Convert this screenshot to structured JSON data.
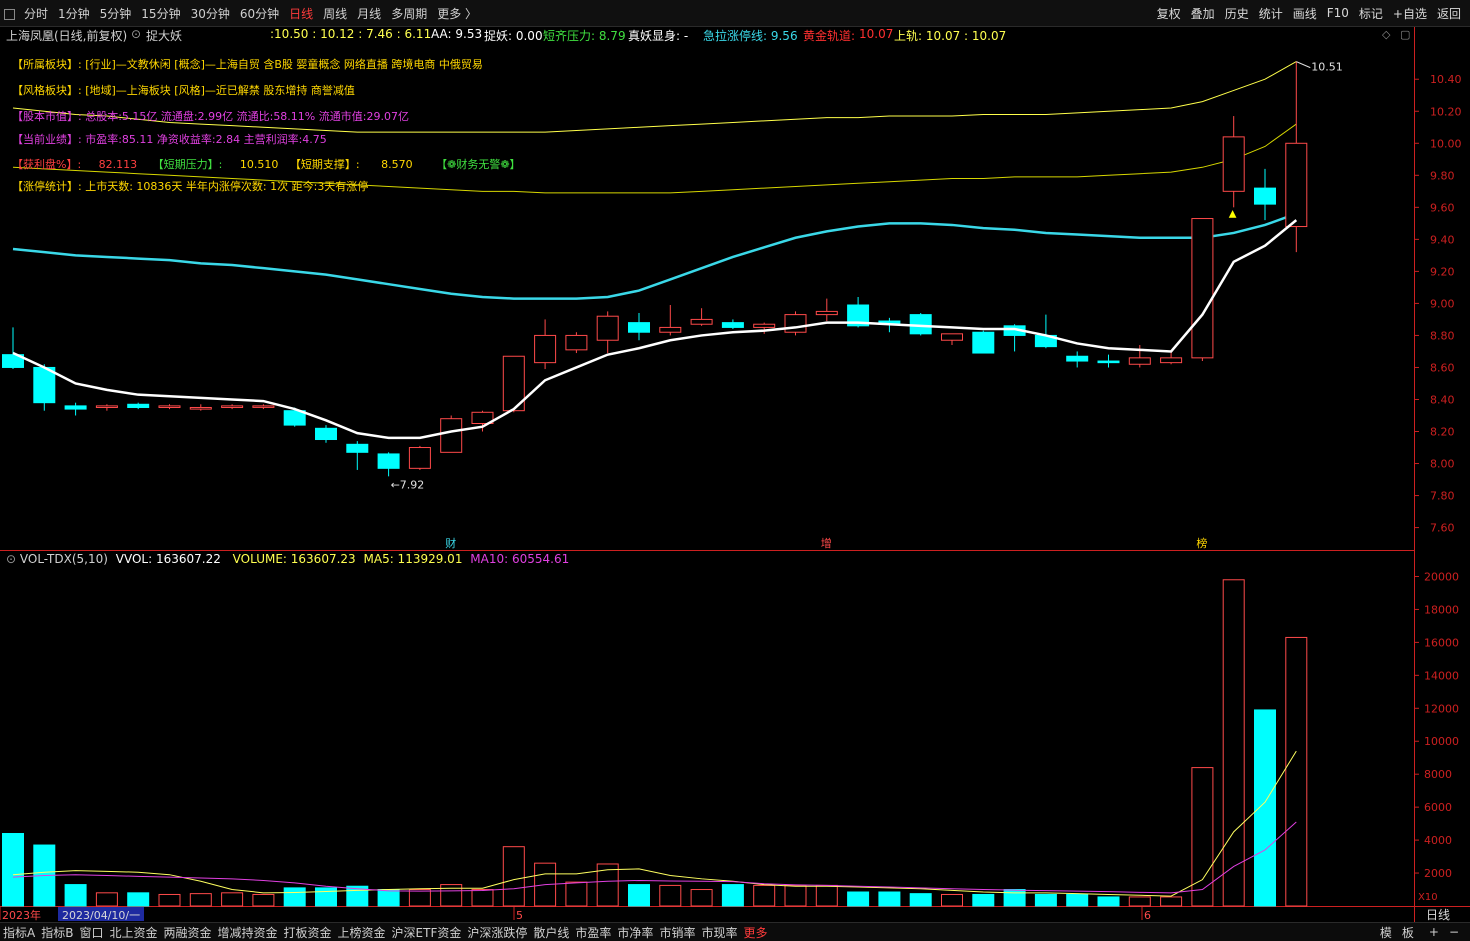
{
  "topbar": {
    "back_icon": "checkbox-square-icon",
    "periods": [
      "分时",
      "1分钟",
      "5分钟",
      "15分钟",
      "30分钟",
      "60分钟",
      "日线",
      "周线",
      "月线",
      "多周期",
      "更多 〉"
    ],
    "active_period": "日线",
    "tools": [
      "复权",
      "叠加",
      "历史",
      "统计",
      "画线",
      "F10",
      "标记",
      "+自选",
      "返回"
    ]
  },
  "infobar": {
    "stock": "上海凤凰(日线,前复权)",
    "indicator_icon": "settings-circle-icon",
    "indicator": "捉大妖",
    "values": ":10.50 : 10.12 : 7.46 : 6.11",
    "aa": "AA: 9.53",
    "zy": "捉妖: 0.00",
    "dqyl": "短齐压力: 8.79",
    "zyxs": "真妖显身: -",
    "jlzt": "急拉涨停线: 9.56",
    "hjgd_label": "黄金轨道:",
    "hjgd_value": "10.07",
    "sg": "上轨: 10.07 : 10.07"
  },
  "fundamentals": [
    {
      "label": "【所属板块】:",
      "text": "[行业]—文教休闲 [概念]—上海自贸 含B股 婴童概念 网络直播 跨境电商 中俄贸易",
      "label_color": "#ffd700",
      "text_color": "#ffd700"
    },
    {
      "label": "【风格板块】:",
      "text": "[地域]—上海板块 [风格]—近已解禁 股东增持 商誉减值",
      "label_color": "#ffd700",
      "text_color": "#ffd700"
    },
    {
      "label": "【股本市值】:",
      "text": "总股本:5.15亿 流通盘:2.99亿 流通比:58.11% 流通市值:29.07亿",
      "label_color": "#e040e0",
      "text_color": "#e040e0"
    },
    {
      "label": "【当前业绩】:",
      "text": "市盈率:85.11 净资收益率:2.84 主营利润率:4.75",
      "label_color": "#e040e0",
      "text_color": "#e040e0"
    },
    {
      "label": "【获利盘%】:",
      "text": "82.113",
      "label_color": "#ff4040",
      "text_color": "#ff4040"
    },
    {
      "label": "【涨停统计】:",
      "text": "上市天数: 10836天 半年内涨停次数: 1次  距今:3天有涨停",
      "label_color": "#ffd700",
      "text_color": "#ffd700"
    }
  ],
  "fund_row5": {
    "dqyl_label": "【短期压力】:",
    "dqyl_value": "10.510",
    "dqzc_label": "【短期支撑】:",
    "dqzc_value": "8.570",
    "cwwj": "【❁财务无警❁】"
  },
  "vol_info": {
    "name": "VOL-TDX(5,10)",
    "vvol": "VVOL: 163607.22",
    "volume": "VOLUME: 163607.23",
    "ma5": "MA5: 113929.01",
    "ma10": "MA10: 60554.61"
  },
  "bottombar": {
    "tabs": [
      "指标A",
      "指标B",
      "窗口",
      "北上资金",
      "两融资金",
      "增减持资金",
      "打板资金",
      "上榜资金",
      "沪深ETF资金",
      "沪深涨跌停",
      "散户线",
      "市盈率",
      "市净率",
      "市销率",
      "市现率",
      "更多"
    ],
    "right": [
      "模",
      "板",
      "+",
      "−"
    ]
  },
  "colors": {
    "up": "#ff4a4a",
    "down": "#00ffff",
    "ma": "#ffffff",
    "env_upper": "#ffff4a",
    "env_mid": "#d6d600",
    "env_lower": "#c8c800",
    "boll_mid": "#3ad8e8",
    "ma5": "#ffff60",
    "ma10": "#e040e0",
    "axis": "#cc2020"
  },
  "chart_data": [
    {
      "type": "candlestick",
      "ylim": [
        7.46,
        10.62
      ],
      "y_ticks": [
        7.6,
        7.8,
        8.0,
        8.2,
        8.4,
        8.6,
        8.8,
        9.0,
        9.2,
        9.4,
        9.6,
        9.8,
        10.0,
        10.2,
        10.4
      ],
      "annotations": {
        "high": "10.51",
        "low": "7.92",
        "markers": [
          "财",
          "增",
          "榜"
        ],
        "tiny_triangle": "▲"
      },
      "ohlc": [
        [
          8.68,
          8.85,
          8.59,
          8.6
        ],
        [
          8.6,
          8.62,
          8.33,
          8.38
        ],
        [
          8.36,
          8.38,
          8.3,
          8.34
        ],
        [
          8.35,
          8.37,
          8.33,
          8.36
        ],
        [
          8.37,
          8.38,
          8.34,
          8.35
        ],
        [
          8.35,
          8.37,
          8.34,
          8.36
        ],
        [
          8.34,
          8.37,
          8.33,
          8.35
        ],
        [
          8.35,
          8.37,
          8.34,
          8.36
        ],
        [
          8.36,
          8.37,
          8.34,
          8.36
        ],
        [
          8.33,
          8.35,
          8.23,
          8.24
        ],
        [
          8.22,
          8.24,
          8.13,
          8.15
        ],
        [
          8.12,
          8.14,
          7.96,
          8.07
        ],
        [
          8.06,
          8.07,
          7.92,
          7.97
        ],
        [
          7.97,
          8.11,
          7.96,
          8.1
        ],
        [
          8.07,
          8.3,
          8.07,
          8.28
        ],
        [
          8.25,
          8.33,
          8.2,
          8.32
        ],
        [
          8.33,
          8.67,
          8.32,
          8.67
        ],
        [
          8.63,
          8.9,
          8.59,
          8.8
        ],
        [
          8.71,
          8.82,
          8.69,
          8.8
        ],
        [
          8.77,
          8.95,
          8.69,
          8.92
        ],
        [
          8.88,
          8.94,
          8.77,
          8.82
        ],
        [
          8.82,
          8.99,
          8.8,
          8.85
        ],
        [
          8.87,
          8.97,
          8.86,
          8.9
        ],
        [
          8.88,
          8.9,
          8.84,
          8.85
        ],
        [
          8.85,
          8.88,
          8.81,
          8.87
        ],
        [
          8.82,
          8.95,
          8.8,
          8.93
        ],
        [
          8.93,
          9.03,
          8.89,
          8.95
        ],
        [
          8.99,
          9.04,
          8.85,
          8.86
        ],
        [
          8.89,
          8.91,
          8.82,
          8.87
        ],
        [
          8.93,
          8.94,
          8.8,
          8.81
        ],
        [
          8.77,
          8.81,
          8.74,
          8.81
        ],
        [
          8.82,
          8.83,
          8.7,
          8.69
        ],
        [
          8.86,
          8.87,
          8.7,
          8.8
        ],
        [
          8.8,
          8.93,
          8.72,
          8.73
        ],
        [
          8.67,
          8.7,
          8.6,
          8.64
        ],
        [
          8.64,
          8.68,
          8.6,
          8.63
        ],
        [
          8.62,
          8.74,
          8.6,
          8.66
        ],
        [
          8.63,
          8.7,
          8.62,
          8.66
        ],
        [
          8.66,
          9.53,
          8.64,
          9.53
        ],
        [
          9.7,
          10.17,
          9.6,
          10.04
        ],
        [
          9.72,
          9.84,
          9.52,
          9.62
        ],
        [
          9.48,
          10.51,
          9.32,
          10.0
        ]
      ],
      "ma": [
        8.69,
        8.6,
        8.5,
        8.46,
        8.43,
        8.42,
        8.41,
        8.4,
        8.39,
        8.34,
        8.27,
        8.19,
        8.16,
        8.16,
        8.2,
        8.23,
        8.34,
        8.52,
        8.6,
        8.68,
        8.72,
        8.77,
        8.8,
        8.82,
        8.83,
        8.85,
        8.88,
        8.88,
        8.87,
        8.86,
        8.85,
        8.84,
        8.84,
        8.8,
        8.75,
        8.72,
        8.71,
        8.7,
        8.93,
        9.26,
        9.36,
        9.52
      ],
      "boll_mid": [
        9.34,
        9.32,
        9.3,
        9.29,
        9.28,
        9.27,
        9.25,
        9.24,
        9.22,
        9.2,
        9.18,
        9.15,
        9.12,
        9.09,
        9.06,
        9.04,
        9.03,
        9.03,
        9.03,
        9.04,
        9.08,
        9.15,
        9.22,
        9.29,
        9.35,
        9.41,
        9.45,
        9.48,
        9.5,
        9.5,
        9.49,
        9.47,
        9.46,
        9.44,
        9.43,
        9.42,
        9.41,
        9.41,
        9.41,
        9.44,
        9.49,
        9.56
      ],
      "env_upper": [
        10.22,
        10.2,
        10.18,
        10.17,
        10.15,
        10.13,
        10.12,
        10.11,
        10.1,
        10.09,
        10.08,
        10.07,
        10.07,
        10.07,
        10.07,
        10.07,
        10.07,
        10.07,
        10.08,
        10.09,
        10.1,
        10.11,
        10.12,
        10.13,
        10.14,
        10.15,
        10.16,
        10.16,
        10.17,
        10.17,
        10.17,
        10.18,
        10.18,
        10.18,
        10.19,
        10.2,
        10.21,
        10.22,
        10.26,
        10.33,
        10.4,
        10.51
      ],
      "env_lower": [
        9.85,
        9.84,
        9.83,
        9.82,
        9.81,
        9.8,
        9.79,
        9.78,
        9.77,
        9.76,
        9.75,
        9.74,
        9.73,
        9.72,
        9.71,
        9.7,
        9.7,
        9.69,
        9.69,
        9.69,
        9.69,
        9.69,
        9.7,
        9.71,
        9.72,
        9.73,
        9.74,
        9.75,
        9.76,
        9.77,
        9.78,
        9.78,
        9.79,
        9.79,
        9.79,
        9.8,
        9.81,
        9.82,
        9.85,
        9.9,
        9.98,
        10.12
      ]
    },
    {
      "type": "bar",
      "ylim": [
        0,
        21000
      ],
      "y_ticks": [
        2000,
        4000,
        6000,
        8000,
        10000,
        12000,
        14000,
        16000,
        18000,
        20000
      ],
      "y_unit": "X10",
      "x_labels": [
        {
          "text": "2023年"
        },
        {
          "text": "2023/04/10/一"
        },
        {
          "text": "5"
        },
        {
          "text": "6"
        }
      ],
      "x_label_indices": [
        0,
        0,
        16,
        37
      ],
      "values": [
        4400,
        3700,
        1300,
        800,
        800,
        700,
        750,
        800,
        700,
        1100,
        1100,
        1200,
        1000,
        1000,
        1300,
        1000,
        3600,
        2600,
        1450,
        2550,
        1300,
        1250,
        1000,
        1300,
        1250,
        1250,
        1250,
        850,
        850,
        750,
        700,
        700,
        1000,
        700,
        700,
        550,
        550,
        550,
        8400,
        19800,
        11900,
        16300
      ],
      "ma5": [
        1900,
        2050,
        2150,
        2100,
        2050,
        1900,
        1500,
        1000,
        800,
        820,
        880,
        950,
        1000,
        1050,
        1080,
        1080,
        1600,
        1950,
        1950,
        2200,
        2250,
        1850,
        1650,
        1500,
        1300,
        1200,
        1200,
        1150,
        1100,
        1050,
        950,
        850,
        800,
        800,
        750,
        700,
        650,
        600,
        1600,
        4500,
        6300,
        9400
      ],
      "ma10": [
        1750,
        1850,
        1900,
        1850,
        1800,
        1750,
        1700,
        1650,
        1550,
        1400,
        1200,
        1050,
        920,
        900,
        920,
        940,
        1050,
        1300,
        1400,
        1500,
        1550,
        1520,
        1500,
        1480,
        1350,
        1280,
        1250,
        1200,
        1150,
        1100,
        1050,
        1000,
        960,
        930,
        900,
        870,
        830,
        800,
        1000,
        2400,
        3400,
        5100
      ]
    }
  ]
}
